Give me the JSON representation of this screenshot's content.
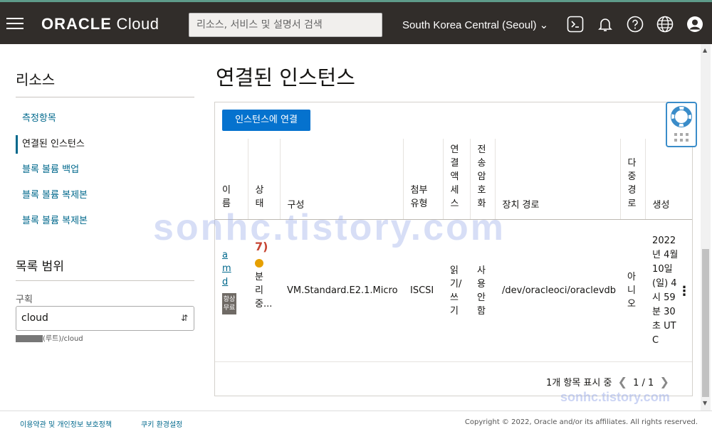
{
  "topbar": {
    "logo": "ORACLE Cloud",
    "logo_bold": "ORACLE",
    "logo_light": "Cloud",
    "search_placeholder": "리소스, 서비스 및 설명서 검색",
    "region": "South Korea Central (Seoul)"
  },
  "sidebar": {
    "title": "리소스",
    "items": [
      {
        "label": "측정항목"
      },
      {
        "label": "연결된 인스턴스"
      },
      {
        "label": "블록 볼륨 백업"
      },
      {
        "label": "블록 볼륨 복제본"
      },
      {
        "label": "블록 볼륨 복제본"
      }
    ],
    "scope_title": "목록 범위",
    "compartment_label": "구획",
    "compartment_value": "cloud",
    "compartment_path": "(루트)/cloud"
  },
  "main": {
    "title": "연결된 인스턴스",
    "attach_button": "인스턴스에 연결",
    "columns": [
      "이름",
      "상태",
      "구성",
      "첨부 유형",
      "연결 액세스",
      "전송 암호화",
      "장치 경로",
      "다중 경로",
      "생성"
    ],
    "rows": [
      {
        "name": "amd",
        "badge": "항상 무료",
        "step": "7)",
        "state": "분리 중...",
        "shape": "VM.Standard.E2.1.Micro",
        "attach_type": "ISCSI",
        "access": "읽기/쓰기",
        "encryption": "사용 안함",
        "device_path": "/dev/oracleoci/oraclevdb",
        "multipath": "아니오",
        "created": "2022년 4월 10일(일) 4시 59분 30초 UTC"
      }
    ],
    "pager_text": "1개 항목 표시 중",
    "page_info": "1 / 1"
  },
  "footer": {
    "terms": "이용약관 및 개인정보 보호정책",
    "cookies": "쿠키 환경설정",
    "copyright": "Copyright © 2022, Oracle and/or its affiliates. All rights reserved."
  },
  "watermark": "sonhc.tistory.com",
  "colors": {
    "topbar": "#312d2a",
    "accent": "#0572ce",
    "link": "#00688c",
    "status_dot": "#e6a000",
    "step": "#c74634"
  }
}
